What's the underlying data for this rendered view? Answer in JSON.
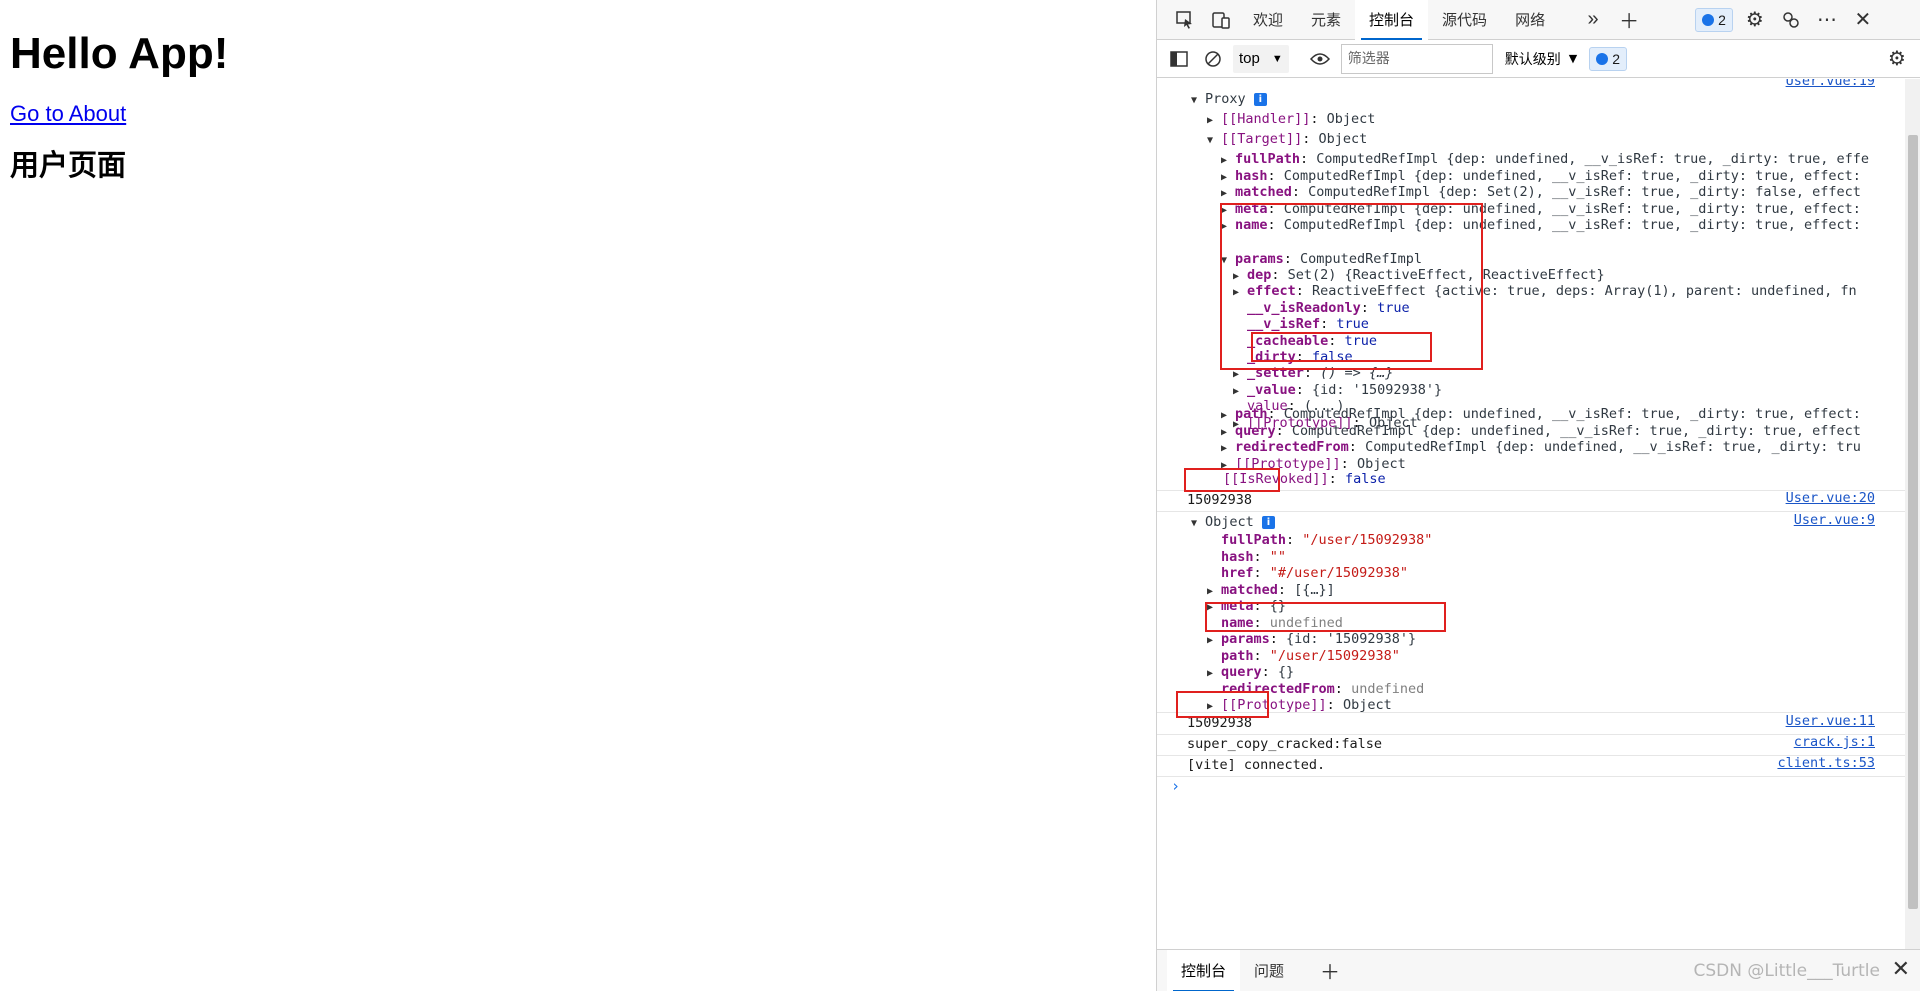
{
  "page": {
    "heading": "Hello App!",
    "link": "Go to About",
    "subheading": "用户页面"
  },
  "devtools": {
    "tabs": [
      "欢迎",
      "元素",
      "控制台",
      "源代码",
      "网络"
    ],
    "issues_count": "2",
    "context": "top",
    "filter_placeholder": "筛选器",
    "levels": "默认级别",
    "levels_count": "2",
    "drawer_tabs": [
      "控制台",
      "问题"
    ],
    "watermark": "CSDN @Little___Turtle"
  },
  "console": {
    "src_19": "User.vue:19",
    "src_20": "User.vue:20",
    "src_9": "User.vue:9",
    "src_11": "User.vue:11",
    "src_crack": "crack.js:1",
    "src_client": "client.ts:53",
    "proxy_label": "Proxy",
    "handler": "[[Handler]]",
    "target": "[[Target]]",
    "object_word": "Object",
    "target_rows": [
      {
        "key": "fullPath",
        "rest": "ComputedRefImpl {dep: undefined, __v_isRef: true, _dirty: true, effe"
      },
      {
        "key": "hash",
        "rest": "ComputedRefImpl {dep: undefined, __v_isRef: true, _dirty: true, effect:"
      },
      {
        "key": "matched",
        "rest": "ComputedRefImpl {dep: Set(2), __v_isRef: true, _dirty: false, effect"
      },
      {
        "key": "meta",
        "rest": "ComputedRefImpl {dep: undefined, __v_isRef: true, _dirty: true, effect:"
      },
      {
        "key": "name",
        "rest": "ComputedRefImpl {dep: undefined, __v_isRef: true, _dirty: true, effect:"
      }
    ],
    "params_key": "params",
    "params_type": "ComputedRefImpl",
    "params_rows": [
      {
        "key": "dep",
        "rest": "Set(2) {ReactiveEffect, ReactiveEffect}"
      },
      {
        "key": "effect",
        "rest": "ReactiveEffect {active: true, deps: Array(1), parent: undefined, fn"
      },
      {
        "key": "__v_isReadonly",
        "rest": "true"
      },
      {
        "key": "__v_isRef",
        "rest": "true"
      },
      {
        "key": "_cacheable",
        "rest": "true"
      },
      {
        "key": "_dirty",
        "rest": "false"
      },
      {
        "key": "_setter",
        "rest": "() => {…}"
      },
      {
        "key": "_value",
        "rest": "{id: '15092938'}"
      },
      {
        "key": "value",
        "rest": "(...)"
      },
      {
        "key": "[[Prototype]]",
        "rest": "Object"
      }
    ],
    "target_rows_after": [
      {
        "key": "path",
        "rest": "ComputedRefImpl {dep: undefined, __v_isRef: true, _dirty: true, effect:"
      },
      {
        "key": "query",
        "rest": "ComputedRefImpl {dep: undefined, __v_isRef: true, _dirty: true, effect"
      },
      {
        "key": "redirectedFrom",
        "rest": "ComputedRefImpl {dep: undefined, __v_isRef: true, _dirty: tru"
      },
      {
        "key": "[[Prototype]]",
        "rest": "Object"
      }
    ],
    "revoked_key": "[[IsRevoked]]",
    "revoked_val": "false",
    "log_value": "15092938",
    "route_rows": [
      {
        "key": "fullPath",
        "rest": "\"/user/15092938\""
      },
      {
        "key": "hash",
        "rest": "\"\""
      },
      {
        "key": "href",
        "rest": "\"#/user/15092938\""
      },
      {
        "key": "matched",
        "rest": "[{…}]"
      },
      {
        "key": "meta",
        "rest": "{}"
      },
      {
        "key": "name",
        "rest": "undefined"
      },
      {
        "key": "params",
        "rest": "{id: '15092938'}"
      },
      {
        "key": "path",
        "rest": "\"/user/15092938\""
      },
      {
        "key": "query",
        "rest": "{}"
      },
      {
        "key": "redirectedFrom",
        "rest": "undefined"
      },
      {
        "key": "[[Prototype]]",
        "rest": "Object"
      }
    ],
    "log_value_2": "15092938",
    "crack_msg": "super_copy_cracked:false",
    "vite_msg": "[vite] connected."
  }
}
